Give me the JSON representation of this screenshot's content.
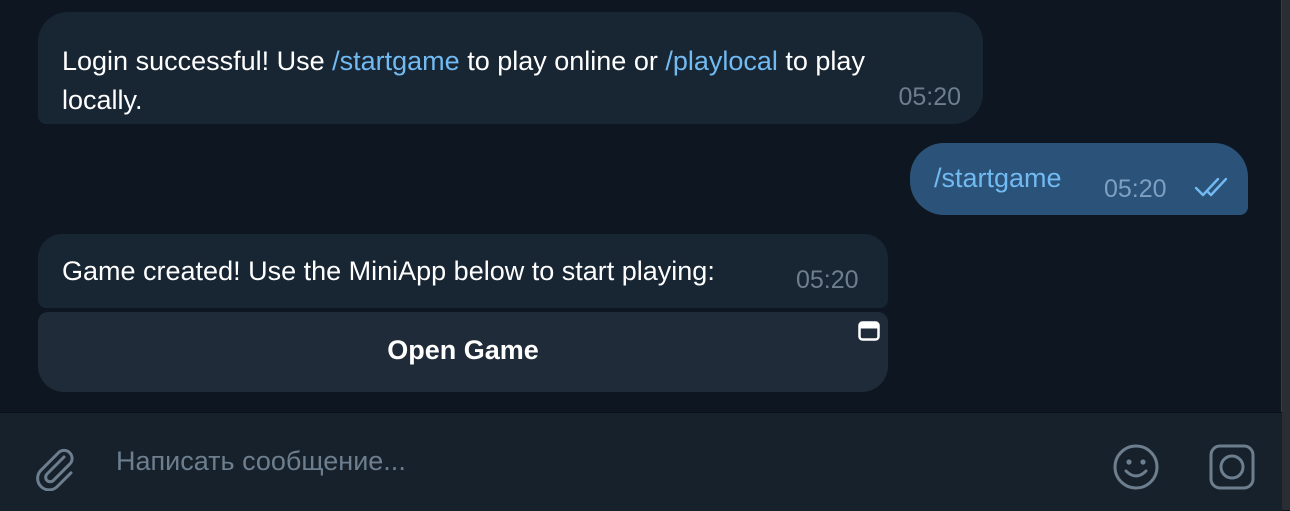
{
  "messages": [
    {
      "text_before": "Login successful! Use ",
      "link1": "/startgame",
      "text_middle": " to play online or ",
      "link2": "/playlocal",
      "text_after": " to play locally.",
      "time": "05:20"
    },
    {
      "text": "/startgame",
      "time": "05:20",
      "status": "read"
    },
    {
      "text": "Game created! Use the MiniApp below to start playing:",
      "time": "05:20"
    }
  ],
  "inline_button": {
    "label": "Open Game",
    "icon": "window-icon"
  },
  "composer": {
    "placeholder": "Написать сообщение...",
    "icons": [
      "paperclip-icon",
      "emoji-icon",
      "video-message-icon"
    ]
  },
  "colors": {
    "background": "#0e1621",
    "incoming_bubble": "#182533",
    "outgoing_bubble": "#2b5278",
    "link": "#71baf2",
    "timestamp": "#6d7f8f"
  }
}
